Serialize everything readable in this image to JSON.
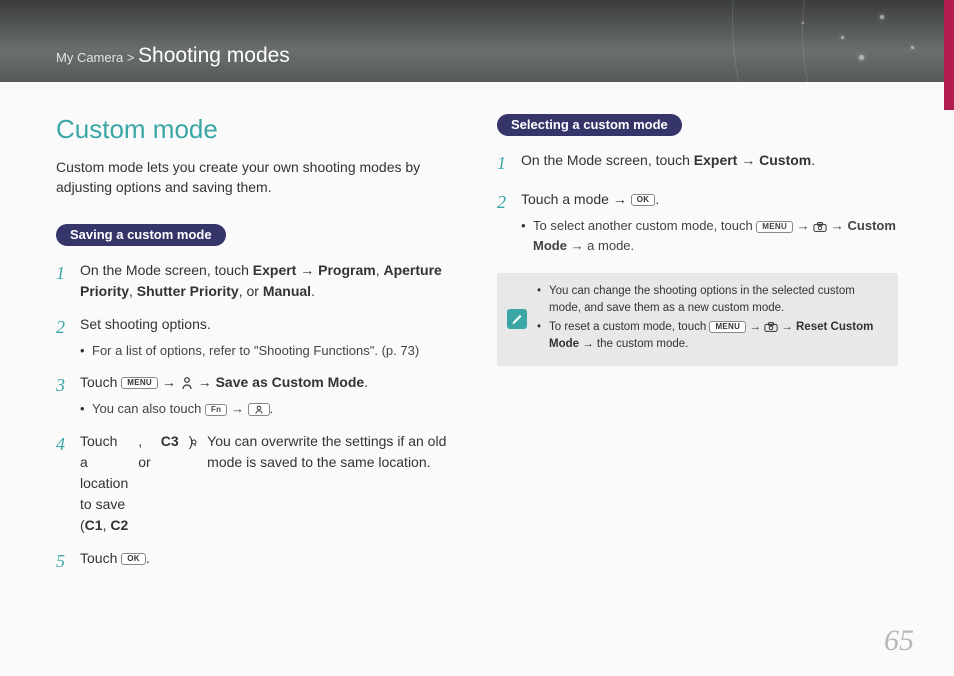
{
  "header": {
    "breadcrumb_root": "My Camera",
    "breadcrumb_sep": ">",
    "section": "Shooting modes"
  },
  "left": {
    "title": "Custom mode",
    "intro": "Custom mode lets you create your own shooting modes by adjusting options and saving them.",
    "pill": "Saving a custom mode",
    "steps": [
      {
        "num": "1",
        "text_pre": "On the Mode screen, touch ",
        "b1": "Expert",
        "arrow1": " → ",
        "b2": "Program",
        "sep1": ", ",
        "b3": "Aperture Priority",
        "sep2": ", ",
        "b4": "Shutter Priority",
        "sep3": ", or ",
        "b5": "Manual",
        "post": "."
      },
      {
        "num": "2",
        "text": "Set shooting options.",
        "sub": "For a list of options, refer to \"Shooting Functions\". (p. 73)"
      },
      {
        "num": "3",
        "pre": "Touch ",
        "menu_btn": "MENU",
        "arrow1": " → ",
        "arrow2": " → ",
        "b1": "Save as Custom Mode",
        "post": ".",
        "sub_pre": "You can also touch ",
        "fn_btn": "Fn",
        "sub_arrow": " → ",
        "sub_post": "."
      },
      {
        "num": "4",
        "pre": "Touch a location to save (",
        "b1": "C1",
        "s1": ", ",
        "b2": "C2",
        "s2": ", or ",
        "b3": "C3",
        "post": ").",
        "sub": "You can overwrite the settings if an old mode is saved to the same location."
      },
      {
        "num": "5",
        "pre": "Touch ",
        "ok_btn": "OK",
        "post": "."
      }
    ]
  },
  "right": {
    "pill": "Selecting a custom mode",
    "steps": [
      {
        "num": "1",
        "pre": "On the Mode screen, touch ",
        "b1": "Expert",
        "arrow": " → ",
        "b2": "Custom",
        "post": "."
      },
      {
        "num": "2",
        "pre": "Touch a mode → ",
        "ok_btn": "OK",
        "post": ".",
        "sub_pre": "To select another custom mode, touch ",
        "menu_btn": "MENU",
        "sub_a1": " → ",
        "sub_a2": " → ",
        "sub_b1": "Custom Mode",
        "sub_a3": " → a mode."
      }
    ],
    "notes": [
      {
        "text": "You can change the shooting options in the selected custom mode, and save them as a new custom mode."
      },
      {
        "pre": "To reset a custom mode, touch ",
        "menu_btn": "MENU",
        "a1": " → ",
        "a2": " → ",
        "b1": "Reset Custom Mode",
        "a3": " → the custom mode."
      }
    ]
  },
  "page_number": "65"
}
